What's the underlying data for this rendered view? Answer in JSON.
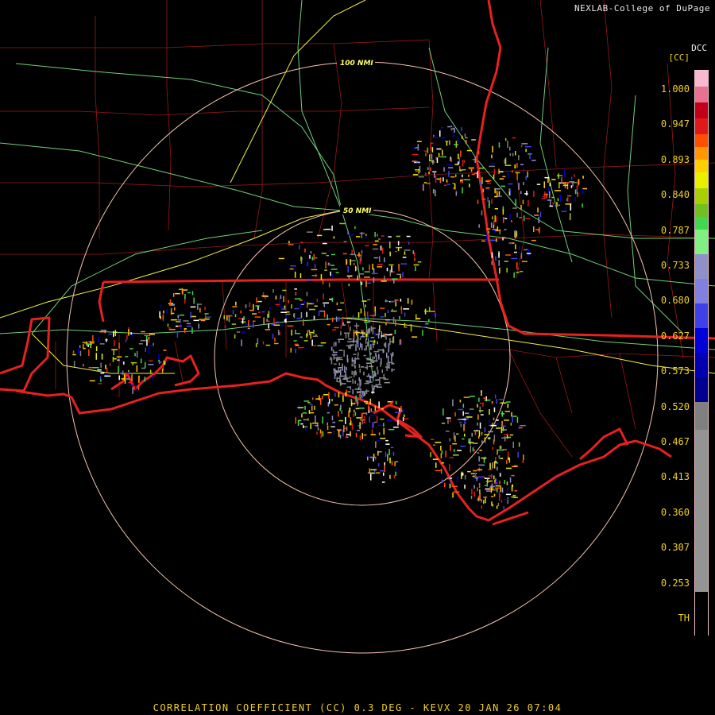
{
  "header": {
    "credit": "NEXLAB-College of DuPage",
    "site_code": "DCC",
    "units": "[CC]"
  },
  "rings": [
    {
      "label": "100 NMI"
    },
    {
      "label": "50 NMI"
    }
  ],
  "colorbar": {
    "labels": [
      "1.000",
      "0.947",
      "0.893",
      "0.840",
      "0.787",
      "0.733",
      "0.680",
      "0.627",
      "0.573",
      "0.520",
      "0.467",
      "0.413",
      "0.360",
      "0.307",
      "0.253",
      "TH"
    ],
    "colors": [
      "#f8b8d0",
      "#e87090",
      "#c00018",
      "#e01818",
      "#ff5000",
      "#ff9800",
      "#ffd000",
      "#e8f000",
      "#a8d000",
      "#70c020",
      "#40d850",
      "#80f080",
      "#9090c8",
      "#8080e0",
      "#4040e8",
      "#0000d8",
      "#0000b0",
      "#000090",
      "#808080",
      "#949494",
      "#000000"
    ]
  },
  "caption": "CORRELATION COEFFICIENT (CC) 0.3 DEG - KEVX 20 JAN 26 07:04"
}
